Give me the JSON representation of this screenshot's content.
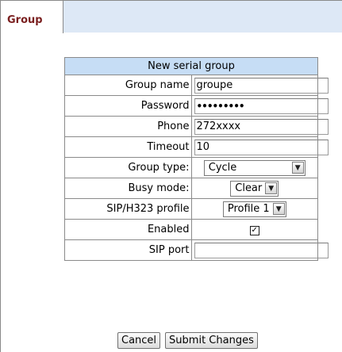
{
  "tab": {
    "label": "Group"
  },
  "form": {
    "title": "New serial group",
    "group_name": {
      "label": "Group name",
      "value": "groupe"
    },
    "password": {
      "label": "Password",
      "value": "•••••••••"
    },
    "phone": {
      "label": "Phone",
      "value": "272xxxx"
    },
    "timeout": {
      "label": "Timeout",
      "value": "10"
    },
    "group_type": {
      "label": "Group type:",
      "value": "Cycle"
    },
    "busy_mode": {
      "label": "Busy mode:",
      "value": "Clear"
    },
    "sip_profile": {
      "label": "SIP/H323 profile",
      "value": "Profile 1"
    },
    "enabled": {
      "label": "Enabled",
      "checked": true,
      "mark": "✓"
    },
    "sip_port": {
      "label": "SIP port",
      "value": ""
    }
  },
  "buttons": {
    "cancel": "Cancel",
    "submit": "Submit Changes"
  },
  "colors": {
    "tab_text": "#7a1f1f",
    "header_bg": "#c6ddf5",
    "tabbar_bg": "#dde8f6"
  }
}
